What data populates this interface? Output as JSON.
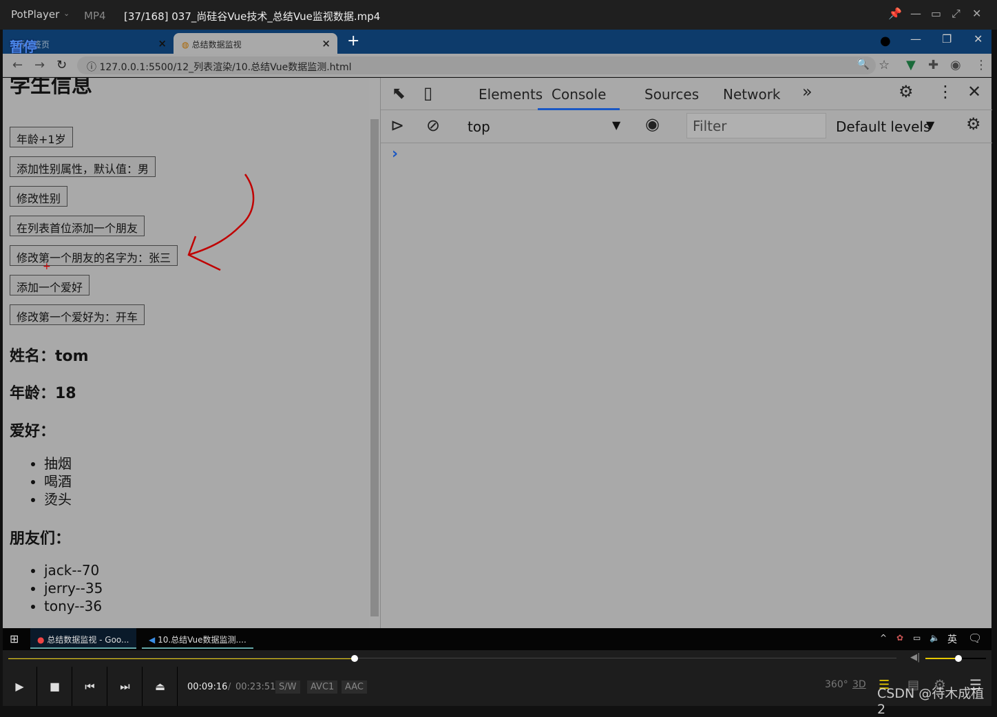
{
  "player": {
    "app": "PotPlayer",
    "format": "MP4",
    "title": "[37/168] 037_尚硅谷Vue技术_总结Vue监视数据.mp4",
    "paused_overlay": "暂停",
    "current_time": "00:09:16",
    "separator": "/",
    "total_time": "00:23:51",
    "tags": [
      "S/W",
      "AVC1",
      "AAC"
    ],
    "progress_fraction": 0.39,
    "volume_fraction": 0.55,
    "buttons_right": [
      "360°",
      "3D"
    ]
  },
  "browser": {
    "tabs": [
      {
        "label": "新标签页"
      },
      {
        "label": "总结数据监视",
        "active": true
      }
    ],
    "url": "127.0.0.1:5500/12_列表渲染/10.总结Vue数据监测.html"
  },
  "page": {
    "heading": "学生信息",
    "buttons": [
      "年龄+1岁",
      "添加性别属性，默认值：男",
      "修改性别",
      "在列表首位添加一个朋友",
      "修改第一个朋友的名字为：张三",
      "添加一个爱好",
      "修改第一个爱好为：开车"
    ],
    "name": "姓名：tom",
    "age": "年龄：18",
    "hobby_title": "爱好：",
    "hobbies": [
      "抽烟",
      "喝酒",
      "烫头"
    ],
    "friends_title": "朋友们：",
    "friends": [
      "jack--70",
      "jerry--35",
      "tony--36"
    ]
  },
  "devtools": {
    "tabs": [
      "Elements",
      "Console",
      "Sources",
      "Network"
    ],
    "active_tab": "Console",
    "context": "top",
    "filter_placeholder": "Filter",
    "levels": "Default levels",
    "prompt": "›"
  },
  "taskbar": {
    "items": [
      "总结数据监视 - Goo...",
      "10.总结Vue数据监测...."
    ],
    "ime": "英"
  },
  "watermark": "CSDN @待木成植2",
  "colors": {
    "accent": "#e6c800",
    "annotation": "#c00000"
  }
}
